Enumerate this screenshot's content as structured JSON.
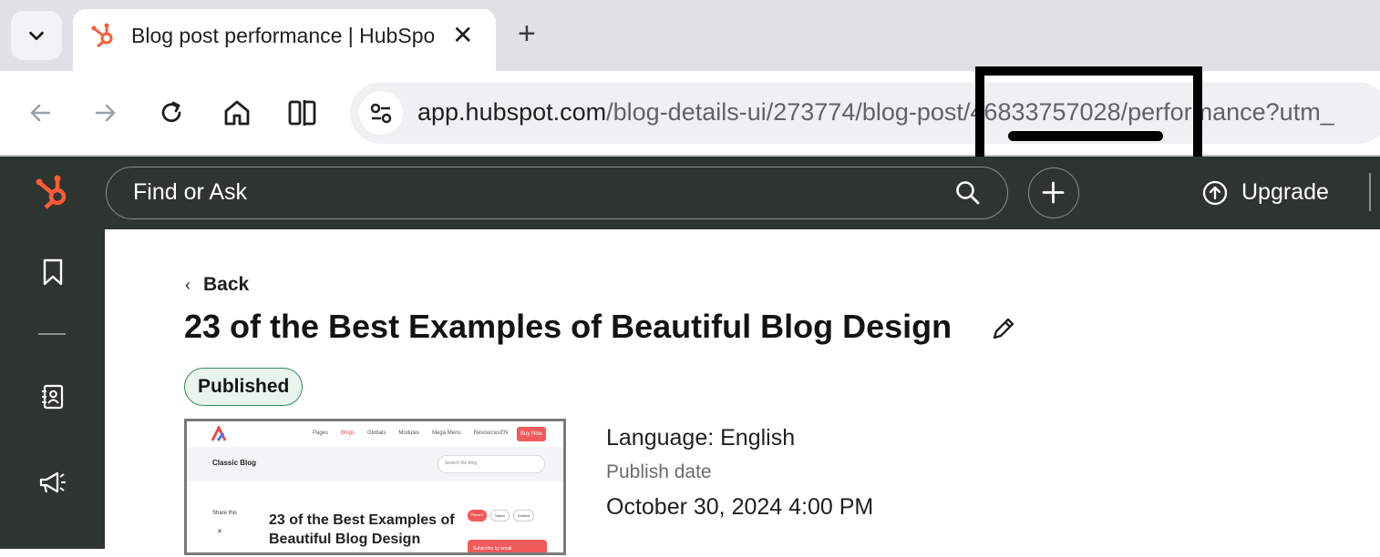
{
  "browser": {
    "tab_title": "Blog post performance | HubSpot",
    "close_glyph": "✕",
    "new_tab_glyph": "+",
    "url_domain": "app.hubspot.com",
    "url_path": "/blog-details-ui/273774/blog-post/46833757028/performance?utm_"
  },
  "hubspot": {
    "search_placeholder": "Find or Ask",
    "upgrade_label": "Upgrade",
    "accent_color": "#ff5c35"
  },
  "page": {
    "back_label": "Back",
    "title": "23 of the Best Examples of Beautiful Blog Design",
    "status": "Published",
    "language_label": "Language: English",
    "publish_date_label": "Publish date",
    "publish_date": "October 30, 2024 4:00 PM"
  },
  "thumbnail": {
    "nav": [
      "Pages",
      "Blogs",
      "Globals",
      "Modules",
      "Mega Menu",
      "Resources"
    ],
    "lang": "EN",
    "cta": "Buy Now",
    "blog_name": "Classic Blog",
    "search_placeholder": "Search the blog",
    "share_label": "Share this",
    "post_title": "23 of the Best Examples of Beautiful Blog Design",
    "pills": [
      "Recent",
      "Topics",
      "Archive"
    ],
    "subscribe": "Subscribe by email"
  }
}
